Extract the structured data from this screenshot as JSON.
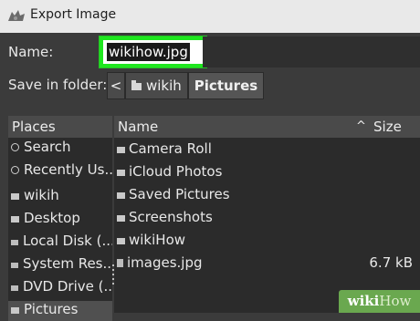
{
  "window": {
    "title": "Export Image",
    "app_icon": "gimp-wilber-icon"
  },
  "form": {
    "name_label": "Name:",
    "filename": "wikihow.jpg",
    "save_in_label": "Save in folder:"
  },
  "breadcrumb": {
    "back_glyph": "<",
    "items": [
      "wikih",
      "Pictures"
    ]
  },
  "places": {
    "header": "Places",
    "items": [
      {
        "label": "Search",
        "icon": "search-icon"
      },
      {
        "label": "Recently Us...",
        "icon": "recent-icon"
      },
      {
        "label": "wikih",
        "icon": "folder-icon"
      },
      {
        "label": "Desktop",
        "icon": "folder-icon"
      },
      {
        "label": "Local Disk (...",
        "icon": "disk-icon"
      },
      {
        "label": "System Res...",
        "icon": "disk-icon"
      },
      {
        "label": "DVD Drive (...",
        "icon": "disk-icon"
      },
      {
        "label": "Pictures",
        "icon": "folder-icon"
      }
    ]
  },
  "files": {
    "col_name": "Name",
    "sort_arrow": "^",
    "col_size": "Size",
    "rows": [
      {
        "name": "Camera Roll",
        "size": "",
        "icon": "folder-icon"
      },
      {
        "name": "iCloud Photos",
        "size": "",
        "icon": "folder-icon"
      },
      {
        "name": "Saved Pictures",
        "size": "",
        "icon": "folder-icon"
      },
      {
        "name": "Screenshots",
        "size": "",
        "icon": "folder-icon"
      },
      {
        "name": "wikiHow",
        "size": "",
        "icon": "folder-icon"
      },
      {
        "name": "images.jpg",
        "size": "6.7 kB",
        "icon": "image-file-icon"
      }
    ]
  },
  "watermark": {
    "part1": "wiki",
    "part2": "How"
  },
  "colors": {
    "highlight": "#1fe71f",
    "background": "#3b3b3b",
    "panel": "#2b2b2b"
  }
}
